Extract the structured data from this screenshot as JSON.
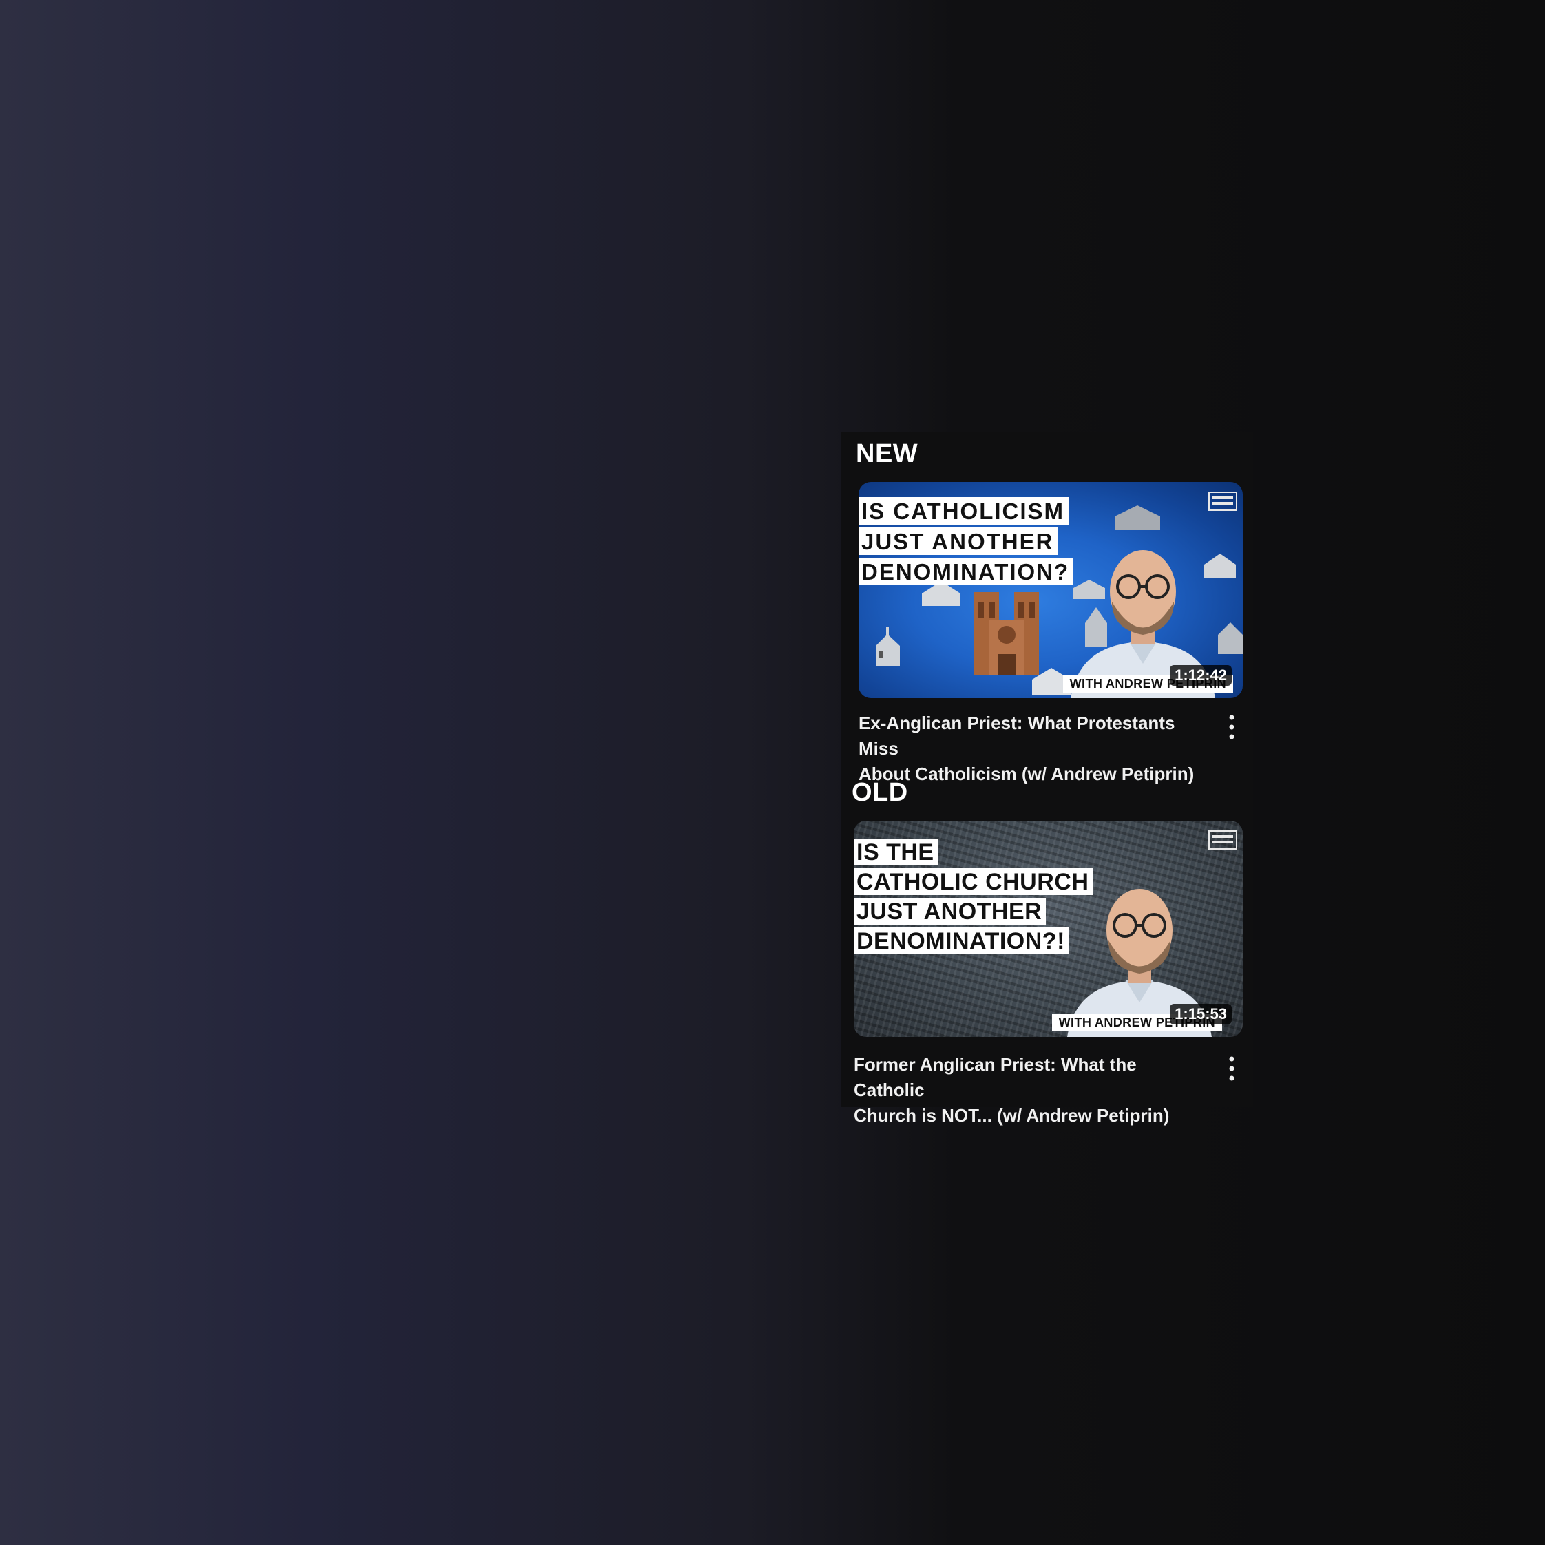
{
  "sections": [
    {
      "label": "NEW",
      "thumbnail": {
        "headline": [
          "IS CATHOLICISM",
          "JUST ANOTHER",
          "DENOMINATION?"
        ],
        "tag": "WITH ANDREW PETIPRIN",
        "duration": "1:12:42"
      },
      "title_lines": [
        "Ex-Anglican Priest: What Protestants Miss",
        "About Catholicism (w/ Andrew Petiprin)"
      ]
    },
    {
      "label": "OLD",
      "thumbnail": {
        "headline": [
          "IS THE",
          "CATHOLIC CHURCH",
          "JUST ANOTHER",
          "DENOMINATION?!"
        ],
        "tag": "WITH ANDREW PETIPRIN",
        "duration": "1:15:53"
      },
      "title_lines": [
        "Former Anglican Priest: What the Catholic",
        "Church is NOT... (w/ Andrew Petiprin)"
      ]
    }
  ],
  "icons": {
    "more": "more-vertical-icon",
    "logo": "channel-logo-icon",
    "cathedral": "cathedral-icon",
    "church": "church-icon"
  }
}
